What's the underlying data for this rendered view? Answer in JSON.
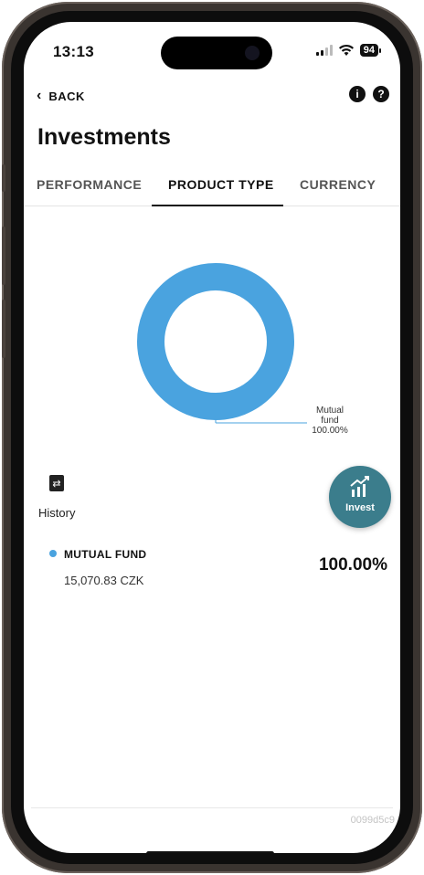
{
  "status_bar": {
    "time": "13:13",
    "battery": "94"
  },
  "nav": {
    "back_label": "BACK"
  },
  "page": {
    "title": "Investments"
  },
  "tabs": [
    {
      "label": "PERFORMANCE",
      "active": false
    },
    {
      "label": "PRODUCT TYPE",
      "active": true
    },
    {
      "label": "CURRENCY",
      "active": false
    }
  ],
  "chart_data": {
    "type": "pie",
    "categories": [
      "Mutual fund"
    ],
    "values": [
      100.0
    ],
    "data_labels": [
      "Mutual\nfund\n100.00%"
    ],
    "colors": [
      "#4aa3df"
    ]
  },
  "callout": {
    "line1": "Mutual",
    "line2": "fund",
    "line3": "100.00%"
  },
  "actions": {
    "history_label": "History",
    "invest_label": "Invest"
  },
  "holdings": [
    {
      "name": "MUTUAL FUND",
      "amount": "15,070.83 CZK",
      "percent": "100.00%",
      "color": "#4aa3df"
    }
  ],
  "footer": {
    "code": "0099d5c9"
  },
  "colors": {
    "accent": "#3b7d8c",
    "donut": "#4aa3df"
  }
}
